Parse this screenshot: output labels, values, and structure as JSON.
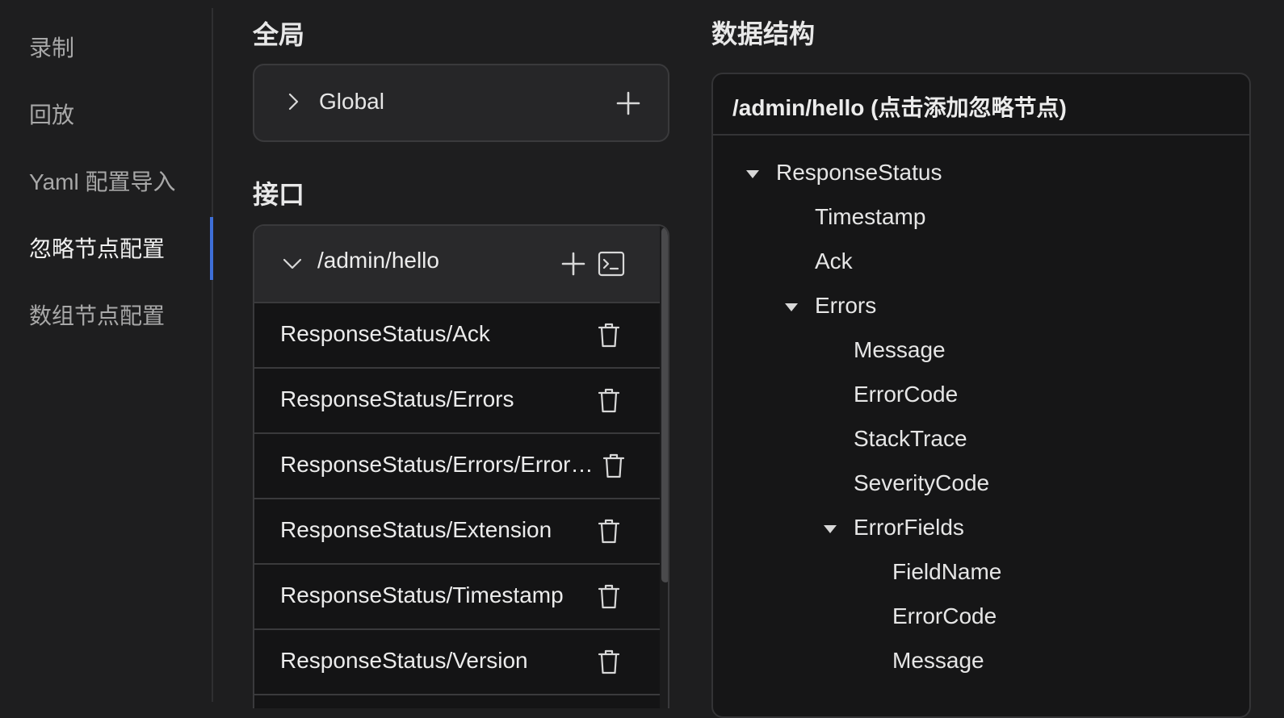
{
  "sidebar": {
    "items": [
      {
        "label": "录制",
        "active": false
      },
      {
        "label": "回放",
        "active": false
      },
      {
        "label": "Yaml 配置导入",
        "active": false
      },
      {
        "label": "忽略节点配置",
        "active": true
      },
      {
        "label": "数组节点配置",
        "active": false
      }
    ]
  },
  "global_section": {
    "title": "全局",
    "item_label": "Global"
  },
  "interface_section": {
    "title": "接口",
    "path": "/admin/hello",
    "ignored_nodes": [
      "ResponseStatus/Ack",
      "ResponseStatus/Errors",
      "ResponseStatus/Errors/ErrorCode",
      "ResponseStatus/Extension",
      "ResponseStatus/Timestamp",
      "ResponseStatus/Version"
    ]
  },
  "data_structure": {
    "title": "数据结构",
    "panel_title": "/admin/hello (点击添加忽略节点)",
    "tree": [
      {
        "label": "ResponseStatus",
        "depth": 0,
        "expanded": true
      },
      {
        "label": "Timestamp",
        "depth": 1
      },
      {
        "label": "Ack",
        "depth": 1
      },
      {
        "label": "Errors",
        "depth": 1,
        "expanded": true
      },
      {
        "label": "Message",
        "depth": 2
      },
      {
        "label": "ErrorCode",
        "depth": 2
      },
      {
        "label": "StackTrace",
        "depth": 2
      },
      {
        "label": "SeverityCode",
        "depth": 2
      },
      {
        "label": "ErrorFields",
        "depth": 2,
        "expanded": true
      },
      {
        "label": "FieldName",
        "depth": 3
      },
      {
        "label": "ErrorCode",
        "depth": 3
      },
      {
        "label": "Message",
        "depth": 3
      }
    ]
  },
  "colors": {
    "background": "#1e1e1f",
    "accent": "#3e6fd8",
    "card_border": "#3a3a3c"
  }
}
